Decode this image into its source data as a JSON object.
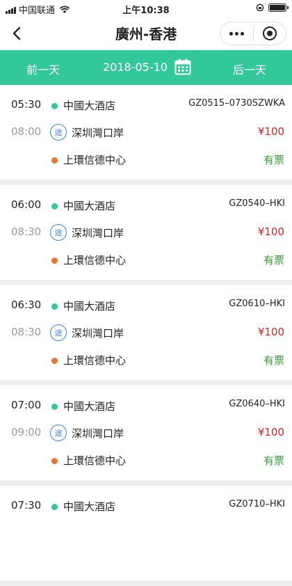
{
  "status_bar": {
    "carrier": "中国联通",
    "time": "上午10:38"
  },
  "nav": {
    "title": "廣州-香港",
    "back_icon": "chevron-left-icon",
    "more_icon": "more-dots-icon",
    "close_icon": "target-icon"
  },
  "date_bar": {
    "prev_label": "前一天",
    "date": "2018-05-10",
    "next_label": "后一天",
    "bg_color": "#33c89a",
    "calendar_icon": "calendar-icon"
  },
  "legend": {
    "via_label": "途"
  },
  "trips": [
    {
      "depart_time": "05:30",
      "arrive_time": "08:00",
      "origin": "中國大酒店",
      "via": "深圳灣口岸",
      "destination": "上環信德中心",
      "code": "GZ0515–0730SZWKA",
      "price": "¥100",
      "availability": "有票"
    },
    {
      "depart_time": "06:00",
      "arrive_time": "08:30",
      "origin": "中國大酒店",
      "via": "深圳灣口岸",
      "destination": "上環信德中心",
      "code": "GZ0540–HKI",
      "price": "¥100",
      "availability": "有票"
    },
    {
      "depart_time": "06:30",
      "arrive_time": "08:30",
      "origin": "中國大酒店",
      "via": "深圳灣口岸",
      "destination": "上環信德中心",
      "code": "GZ0610–HKI",
      "price": "¥100",
      "availability": "有票"
    },
    {
      "depart_time": "07:00",
      "arrive_time": "09:00",
      "origin": "中國大酒店",
      "via": "深圳灣口岸",
      "destination": "上環信德中心",
      "code": "GZ0640–HKI",
      "price": "¥100",
      "availability": "有票"
    },
    {
      "depart_time": "07:30",
      "arrive_time": "",
      "origin": "中國大酒店",
      "via": "",
      "destination": "",
      "code": "GZ0710–HKI",
      "price": "",
      "availability": ""
    }
  ]
}
